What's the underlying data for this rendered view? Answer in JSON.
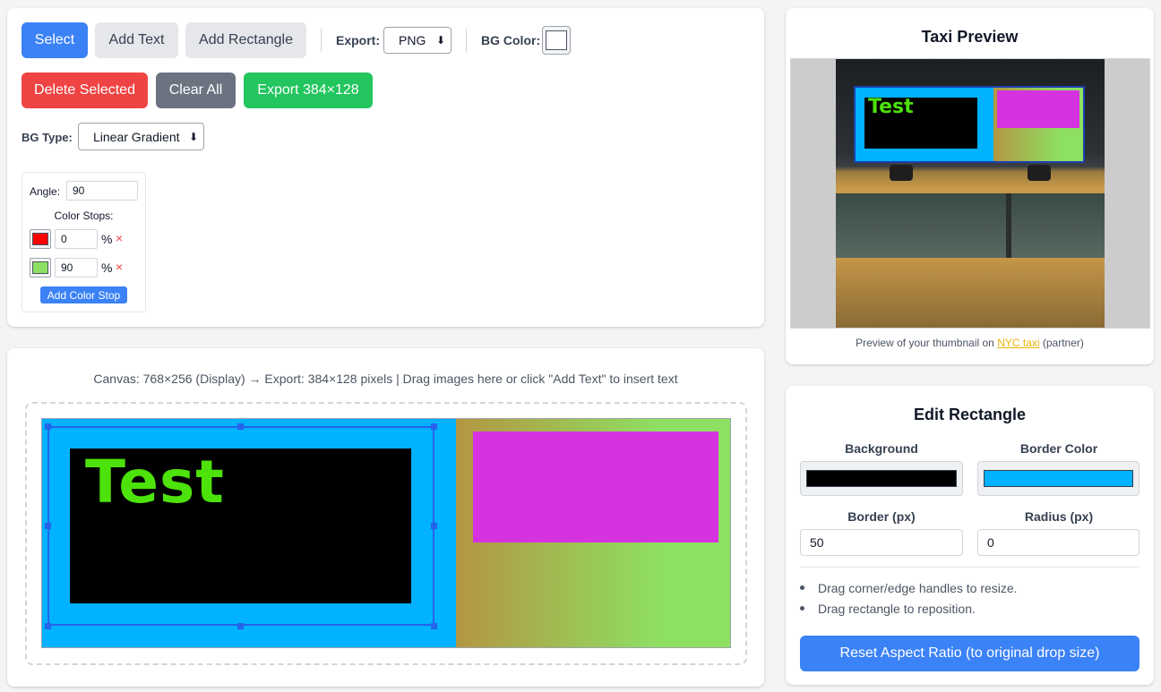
{
  "colors": {
    "primary": "#3b82f6",
    "danger": "#ef4444",
    "success": "#22c55e",
    "neutral": "#6b7280",
    "gradient_start": "#ff0000",
    "gradient_end": "#8ee063",
    "rect_background": "#000000",
    "rect_border": "#00b2ff",
    "text_color": "#4ce20a",
    "magenta": "#d633e0"
  },
  "toolbar": {
    "select_label": "Select",
    "add_text_label": "Add Text",
    "add_rect_label": "Add Rectangle",
    "export_label": "Export:",
    "export_format": "PNG",
    "bg_color_label": "BG Color:",
    "delete_label": "Delete Selected",
    "clear_label": "Clear All",
    "export_button_label": "Export 384×128",
    "bg_type_label": "BG Type:",
    "bg_type_value": "Linear Gradient"
  },
  "gradient": {
    "angle_label": "Angle:",
    "angle_value": "90",
    "stops_label": "Color Stops:",
    "stops": [
      {
        "color": "#ff0000",
        "position": "0",
        "unit": "%"
      },
      {
        "color": "#8ee063",
        "position": "90",
        "unit": "%"
      }
    ],
    "add_stop_label": "Add Color Stop",
    "remove_icon": "×"
  },
  "canvas": {
    "info": "Canvas: 768×256 (Display) → Export: 384×128 pixels | Drag images here or click \"Add Text\" to insert text",
    "text_element": "Test"
  },
  "preview": {
    "title": "Taxi Preview",
    "caption_before": "Preview of your thumbnail on ",
    "caption_link": "NYC taxi",
    "caption_after": " (partner)"
  },
  "edit_rectangle": {
    "title": "Edit Rectangle",
    "background_label": "Background",
    "border_color_label": "Border Color",
    "border_label": "Border (px)",
    "border_value": "50",
    "radius_label": "Radius (px)",
    "radius_value": "0",
    "tips": [
      "Drag corner/edge handles to resize.",
      "Drag rectangle to reposition."
    ],
    "reset_label": "Reset Aspect Ratio (to original drop size)"
  }
}
